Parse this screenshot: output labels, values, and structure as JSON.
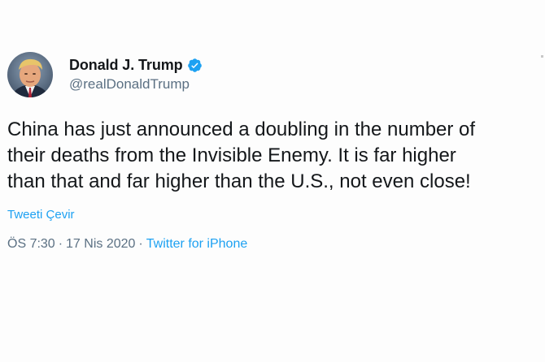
{
  "author": {
    "display_name": "Donald J. Trump",
    "handle": "@realDonaldTrump",
    "verified": true,
    "verified_icon": "verified-badge-icon",
    "verified_color": "#1da1f2"
  },
  "tweet": {
    "text_lines": [
      "China has just announced a doubling in the number of",
      "their deaths from the Invisible Enemy. It is far higher",
      "than that and far higher than the U.S., not even close!"
    ],
    "translate_label": "Tweeti Çevir",
    "time": "ÖS 7:30",
    "date": "17 Nis 2020",
    "separator": "·",
    "source": "Twitter for iPhone"
  },
  "colors": {
    "text": "#14171a",
    "secondary": "#5b7083",
    "link": "#1da1f2",
    "background": "#fdfdfd"
  }
}
